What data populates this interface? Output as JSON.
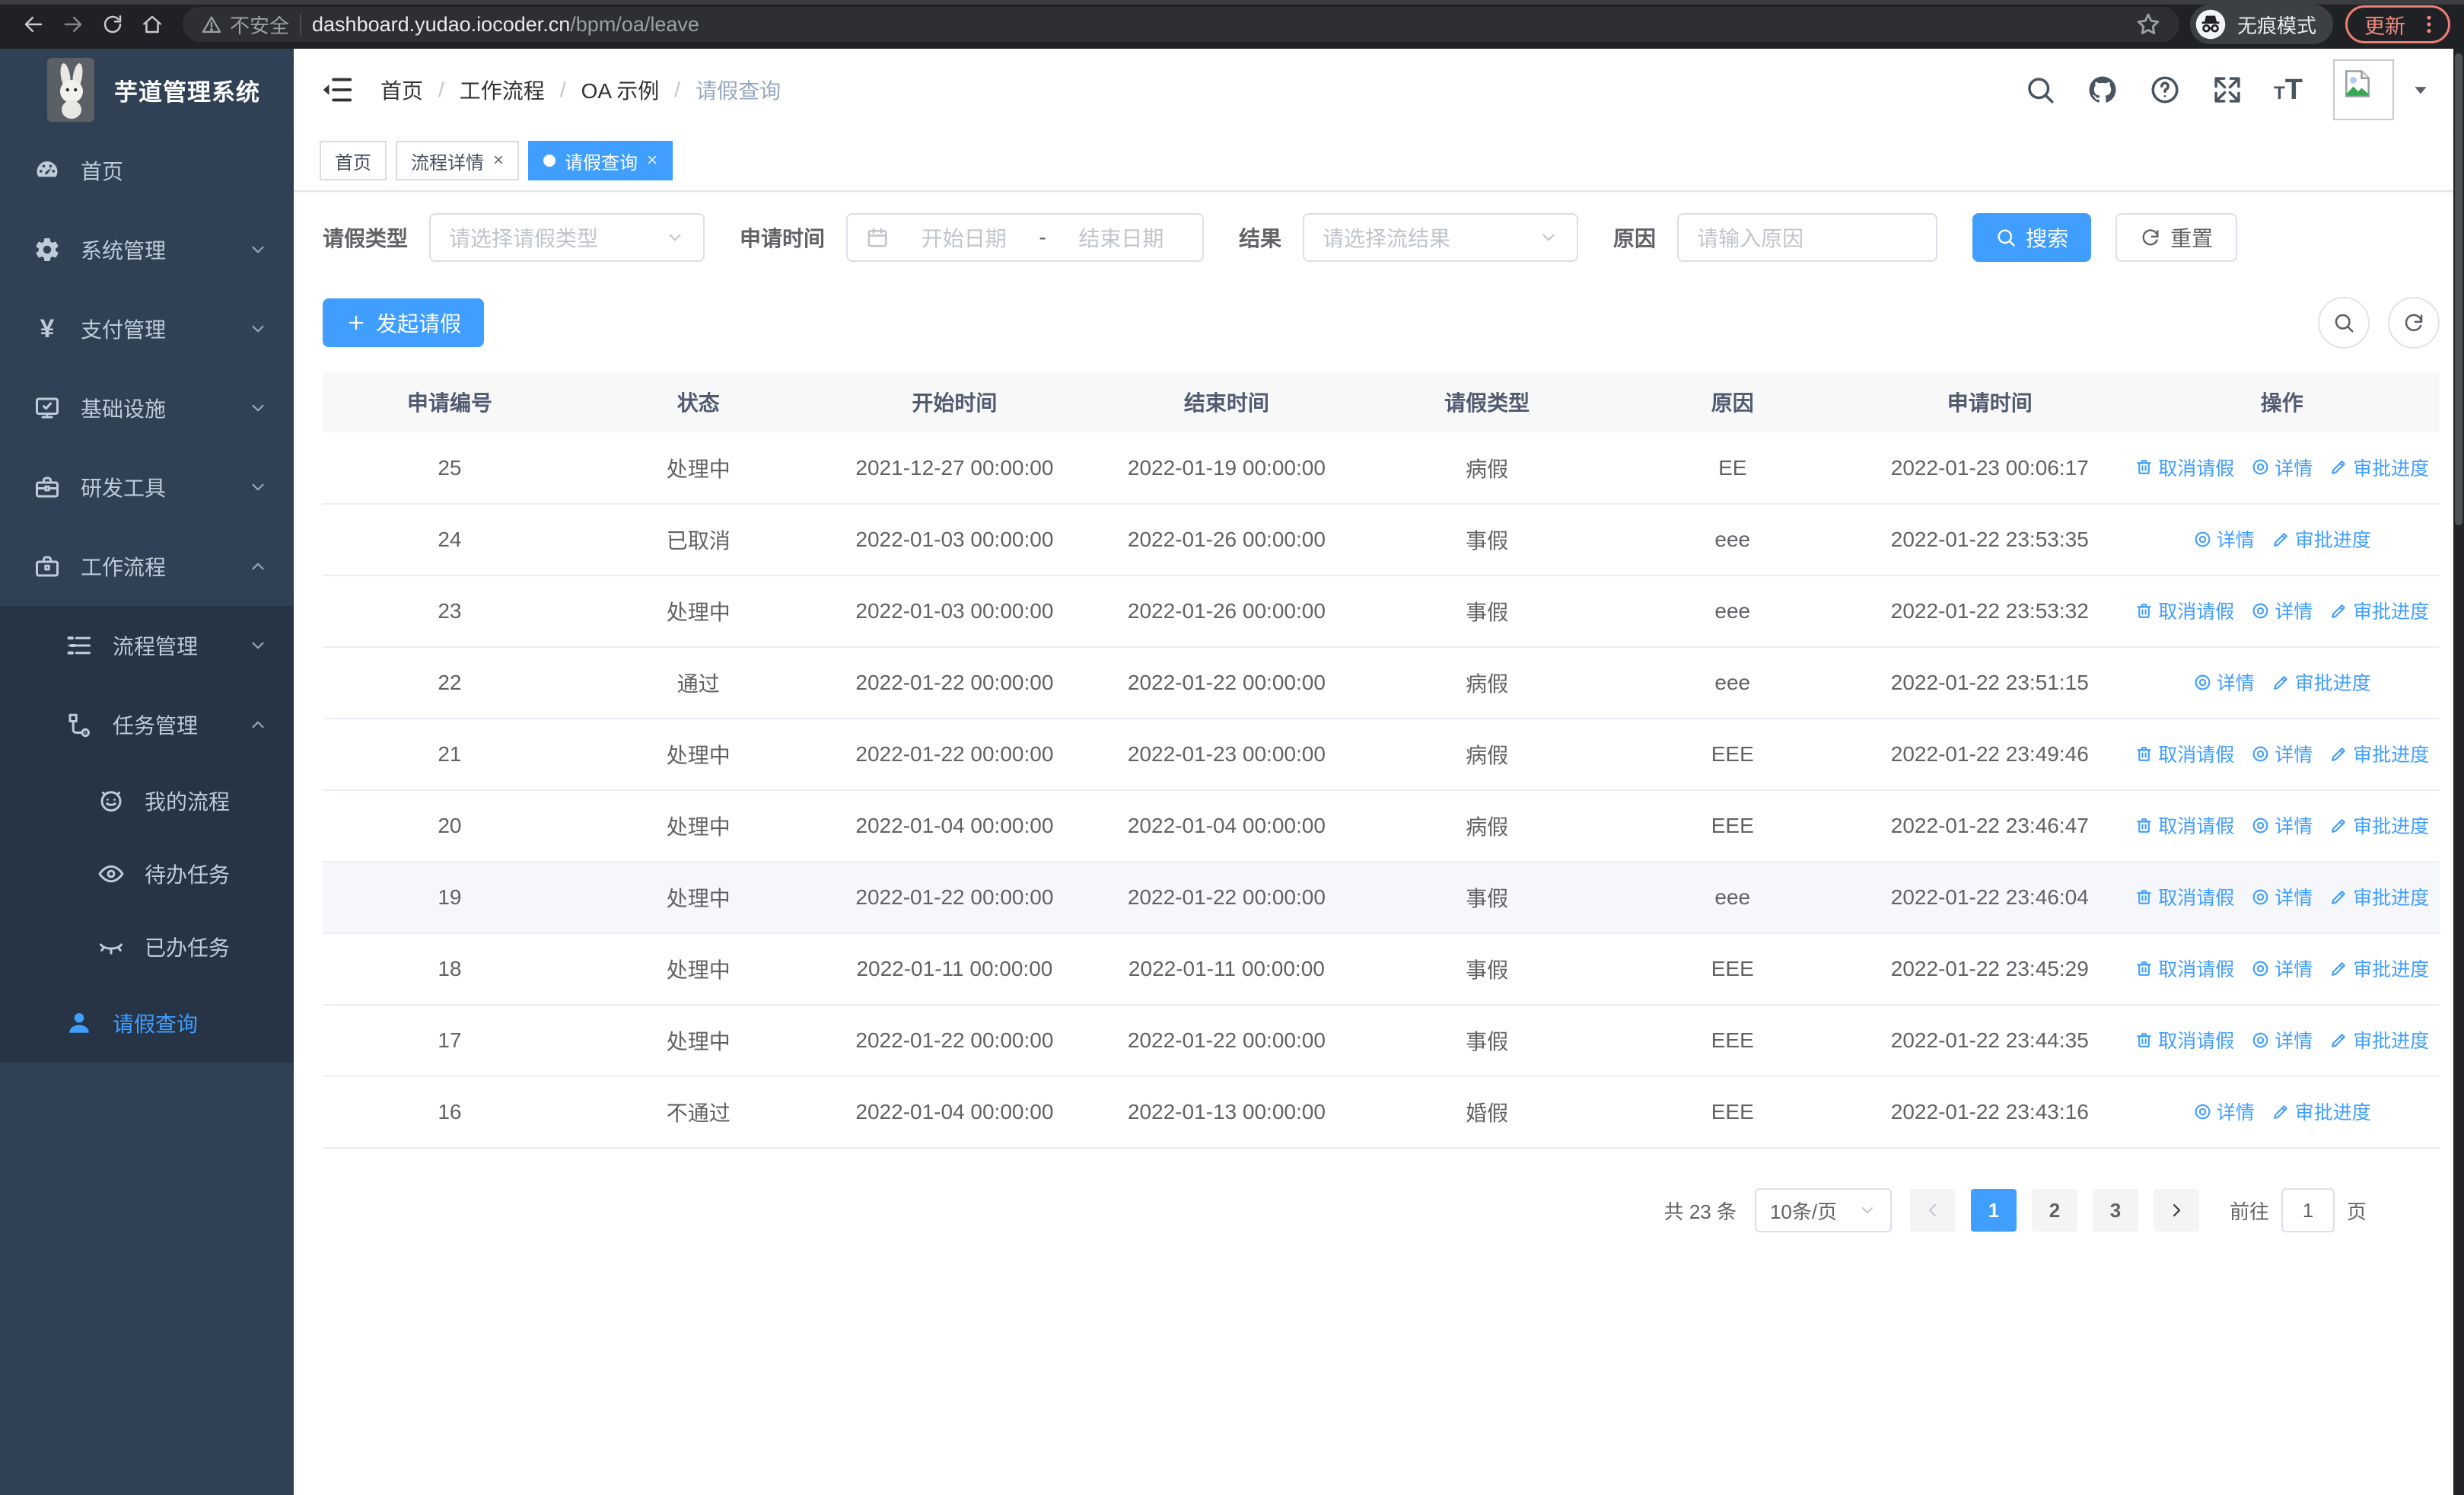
{
  "colors": {
    "primary": "#409eff",
    "sidebar_bg": "#304156",
    "submenu_bg": "#263445"
  },
  "browser": {
    "security_label": "不安全",
    "url_host": "dashboard.yudao.iocoder.cn",
    "url_path": "/bpm/oa/leave",
    "incognito_label": "无痕模式",
    "update_label": "更新"
  },
  "sidebar": {
    "app_title": "芋道管理系统",
    "items": [
      {
        "key": "home",
        "icon": "dashboard-icon",
        "label": "首页"
      },
      {
        "key": "system",
        "icon": "gear-icon",
        "label": "系统管理",
        "chevron": "down"
      },
      {
        "key": "payment",
        "icon": "yen-icon",
        "label": "支付管理",
        "chevron": "down"
      },
      {
        "key": "infra",
        "icon": "monitor-icon",
        "label": "基础设施",
        "chevron": "down"
      },
      {
        "key": "devtools",
        "icon": "toolbox-icon",
        "label": "研发工具",
        "chevron": "down"
      },
      {
        "key": "workflow",
        "icon": "briefcase-icon",
        "label": "工作流程",
        "chevron": "up",
        "children": [
          {
            "key": "process-mgmt",
            "icon": "flow-list-icon",
            "label": "流程管理",
            "chevron": "down"
          },
          {
            "key": "task-mgmt",
            "icon": "tree-icon",
            "label": "任务管理",
            "chevron": "up",
            "children": [
              {
                "key": "my-process",
                "icon": "robot-icon",
                "label": "我的流程"
              },
              {
                "key": "todo-tasks",
                "icon": "eye-icon",
                "label": "待办任务"
              },
              {
                "key": "done-tasks",
                "icon": "eye-closed-icon",
                "label": "已办任务"
              }
            ]
          },
          {
            "key": "leave-query",
            "icon": "user-icon",
            "label": "请假查询",
            "active": true
          }
        ]
      }
    ]
  },
  "header": {
    "breadcrumb": [
      "首页",
      "工作流程",
      "OA 示例",
      "请假查询"
    ],
    "icons": [
      "search-icon",
      "github-icon",
      "help-icon",
      "fullscreen-icon"
    ]
  },
  "tabs": [
    {
      "label": "首页",
      "closable": false,
      "active": false
    },
    {
      "label": "流程详情",
      "closable": true,
      "active": false
    },
    {
      "label": "请假查询",
      "closable": true,
      "active": true
    }
  ],
  "filters": {
    "leave_type_label": "请假类型",
    "leave_type_placeholder": "请选择请假类型",
    "apply_time_label": "申请时间",
    "start_date_placeholder": "开始日期",
    "range_separator": "-",
    "end_date_placeholder": "结束日期",
    "result_label": "结果",
    "result_placeholder": "请选择流结果",
    "reason_label": "原因",
    "reason_placeholder": "请输入原因",
    "search_label": "搜索",
    "reset_label": "重置"
  },
  "toolbar": {
    "create_label": "发起请假"
  },
  "table": {
    "columns": [
      "申请编号",
      "状态",
      "开始时间",
      "结束时间",
      "请假类型",
      "原因",
      "申请时间",
      "操作"
    ],
    "action_labels": {
      "cancel": "取消请假",
      "detail": "详情",
      "progress": "审批进度"
    },
    "rows": [
      {
        "id": "25",
        "status": "处理中",
        "start": "2021-12-27 00:00:00",
        "end": "2022-01-19 00:00:00",
        "type": "病假",
        "reason": "EE",
        "apply_time": "2022-01-23 00:06:17",
        "actions": [
          "cancel",
          "detail",
          "progress"
        ],
        "hover": false
      },
      {
        "id": "24",
        "status": "已取消",
        "start": "2022-01-03 00:00:00",
        "end": "2022-01-26 00:00:00",
        "type": "事假",
        "reason": "eee",
        "apply_time": "2022-01-22 23:53:35",
        "actions": [
          "detail",
          "progress"
        ],
        "hover": false
      },
      {
        "id": "23",
        "status": "处理中",
        "start": "2022-01-03 00:00:00",
        "end": "2022-01-26 00:00:00",
        "type": "事假",
        "reason": "eee",
        "apply_time": "2022-01-22 23:53:32",
        "actions": [
          "cancel",
          "detail",
          "progress"
        ],
        "hover": false
      },
      {
        "id": "22",
        "status": "通过",
        "start": "2022-01-22 00:00:00",
        "end": "2022-01-22 00:00:00",
        "type": "病假",
        "reason": "eee",
        "apply_time": "2022-01-22 23:51:15",
        "actions": [
          "detail",
          "progress"
        ],
        "hover": false
      },
      {
        "id": "21",
        "status": "处理中",
        "start": "2022-01-22 00:00:00",
        "end": "2022-01-23 00:00:00",
        "type": "病假",
        "reason": "EEE",
        "apply_time": "2022-01-22 23:49:46",
        "actions": [
          "cancel",
          "detail",
          "progress"
        ],
        "hover": false
      },
      {
        "id": "20",
        "status": "处理中",
        "start": "2022-01-04 00:00:00",
        "end": "2022-01-04 00:00:00",
        "type": "病假",
        "reason": "EEE",
        "apply_time": "2022-01-22 23:46:47",
        "actions": [
          "cancel",
          "detail",
          "progress"
        ],
        "hover": false
      },
      {
        "id": "19",
        "status": "处理中",
        "start": "2022-01-22 00:00:00",
        "end": "2022-01-22 00:00:00",
        "type": "事假",
        "reason": "eee",
        "apply_time": "2022-01-22 23:46:04",
        "actions": [
          "cancel",
          "detail",
          "progress"
        ],
        "hover": true
      },
      {
        "id": "18",
        "status": "处理中",
        "start": "2022-01-11 00:00:00",
        "end": "2022-01-11 00:00:00",
        "type": "事假",
        "reason": "EEE",
        "apply_time": "2022-01-22 23:45:29",
        "actions": [
          "cancel",
          "detail",
          "progress"
        ],
        "hover": false
      },
      {
        "id": "17",
        "status": "处理中",
        "start": "2022-01-22 00:00:00",
        "end": "2022-01-22 00:00:00",
        "type": "事假",
        "reason": "EEE",
        "apply_time": "2022-01-22 23:44:35",
        "actions": [
          "cancel",
          "detail",
          "progress"
        ],
        "hover": false
      },
      {
        "id": "16",
        "status": "不通过",
        "start": "2022-01-04 00:00:00",
        "end": "2022-01-13 00:00:00",
        "type": "婚假",
        "reason": "EEE",
        "apply_time": "2022-01-22 23:43:16",
        "actions": [
          "detail",
          "progress"
        ],
        "hover": false
      }
    ]
  },
  "pagination": {
    "total_label": "共 23 条",
    "page_size": "10条/页",
    "pages": [
      {
        "label": "1",
        "active": true
      },
      {
        "label": "2",
        "active": false
      },
      {
        "label": "3",
        "active": false
      }
    ],
    "goto_label": "前往",
    "goto_value": "1",
    "page_suffix": "页"
  }
}
